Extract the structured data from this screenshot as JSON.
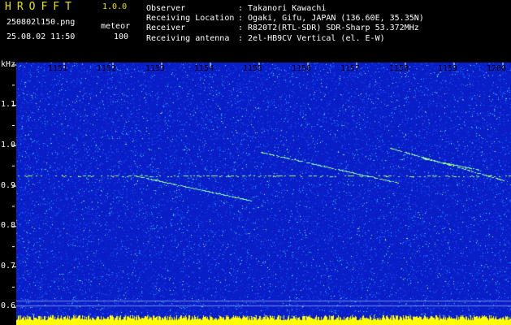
{
  "app": {
    "name": "HROFFT",
    "version": "1.0.0"
  },
  "file": {
    "name": "250802l150.png",
    "mode": "meteor",
    "datetime": "25.08.02 11:50",
    "count": "100"
  },
  "info": [
    {
      "label": "Observer",
      "value": ": Takanori Kawachi"
    },
    {
      "label": "Receiving Location",
      "value": ": Ogaki, Gifu, JAPAN (136.60E, 35.35N)"
    },
    {
      "label": "Receiver",
      "value": ": R820T2(RTL-SDR) SDR-Sharp 53.372MHz"
    },
    {
      "label": "Receiving antenna",
      "value": ": 2el-HB9CV Vertical (el. E-W)"
    }
  ],
  "axis": {
    "y_unit": "kHz",
    "y_ticks": [
      "1.1",
      "1.0",
      "0.9",
      "0.8",
      "0.7",
      "0.6"
    ],
    "x_ticks": [
      "1151",
      "1152",
      "1153",
      "1154",
      "1155",
      "1156",
      "1157",
      "1158",
      "1159",
      "1200"
    ]
  },
  "colors": {
    "background": "#000000",
    "spectrogram_base": "#0a1ec8",
    "noise": "#1e64ff",
    "speckle": "#28d2ff",
    "signal": "#aaff66",
    "bottom_band": "#ffff00",
    "text": "#ffffff",
    "title": "#e6e600"
  }
}
